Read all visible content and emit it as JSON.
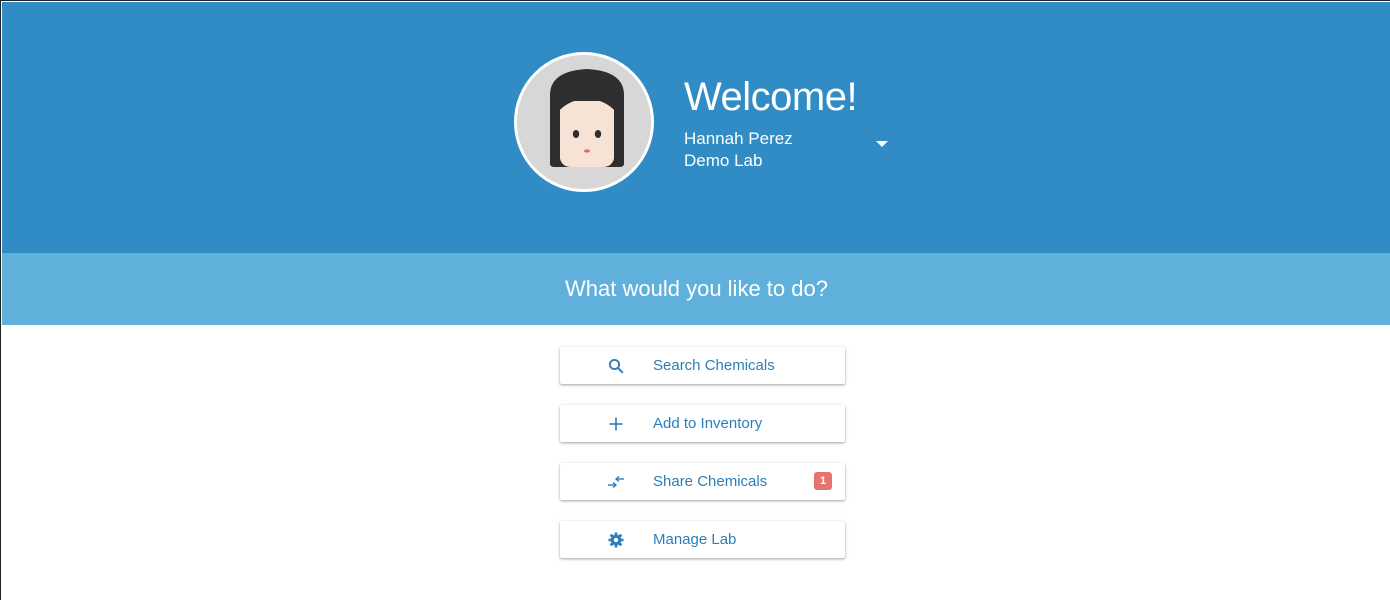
{
  "header": {
    "welcome": "Welcome!",
    "user_name": "Hannah Perez",
    "lab_name": "Demo Lab",
    "background_color": "#318bc4"
  },
  "prompt": {
    "text": "What would you like to do?",
    "background_color": "#5fb0db"
  },
  "actions": [
    {
      "icon": "search-icon",
      "label": "Search Chemicals"
    },
    {
      "icon": "plus-icon",
      "label": "Add to Inventory"
    },
    {
      "icon": "share-arrows-icon",
      "label": "Share Chemicals",
      "badge": "1"
    },
    {
      "icon": "gear-icon",
      "label": "Manage Lab"
    }
  ],
  "accent_color": "#2a7fba",
  "badge_color": "#e5746e"
}
